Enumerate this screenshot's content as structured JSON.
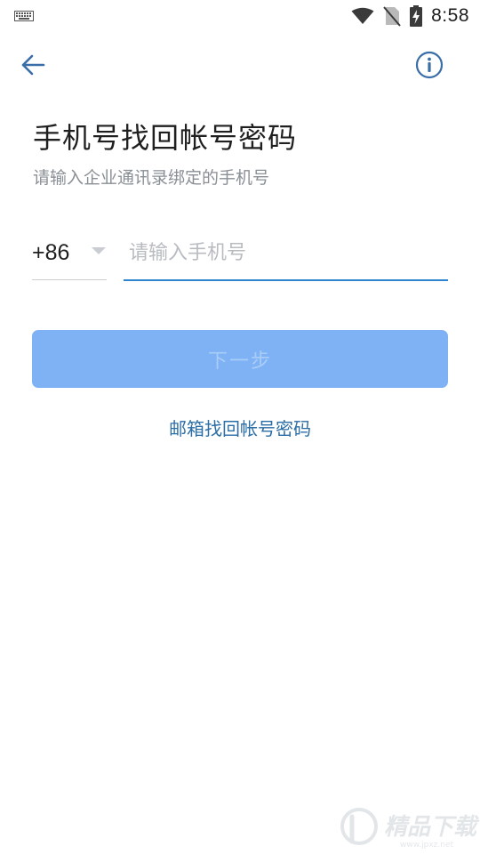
{
  "status_bar": {
    "time": "8:58",
    "icons": [
      "keyboard-icon",
      "wifi-icon",
      "no-sim-icon",
      "battery-charging-icon"
    ]
  },
  "nav": {
    "back_icon": "arrow-left-icon",
    "info_icon": "info-circle-icon"
  },
  "header": {
    "title": "手机号找回帐号密码",
    "subtitle": "请输入企业通讯录绑定的手机号"
  },
  "phone_form": {
    "country_code": "+86",
    "phone_placeholder": "请输入手机号",
    "phone_value": ""
  },
  "actions": {
    "next_label": "下一步",
    "email_recovery_label": "邮箱找回帐号密码"
  },
  "watermark": {
    "text": "精品下载",
    "url_text": "www.jpxz.net"
  },
  "colors": {
    "accent_blue": "#2f84d0",
    "button_disabled": "#7fb2f5",
    "link_blue": "#2b6ea6",
    "icon_blue": "#3a6ea8"
  }
}
